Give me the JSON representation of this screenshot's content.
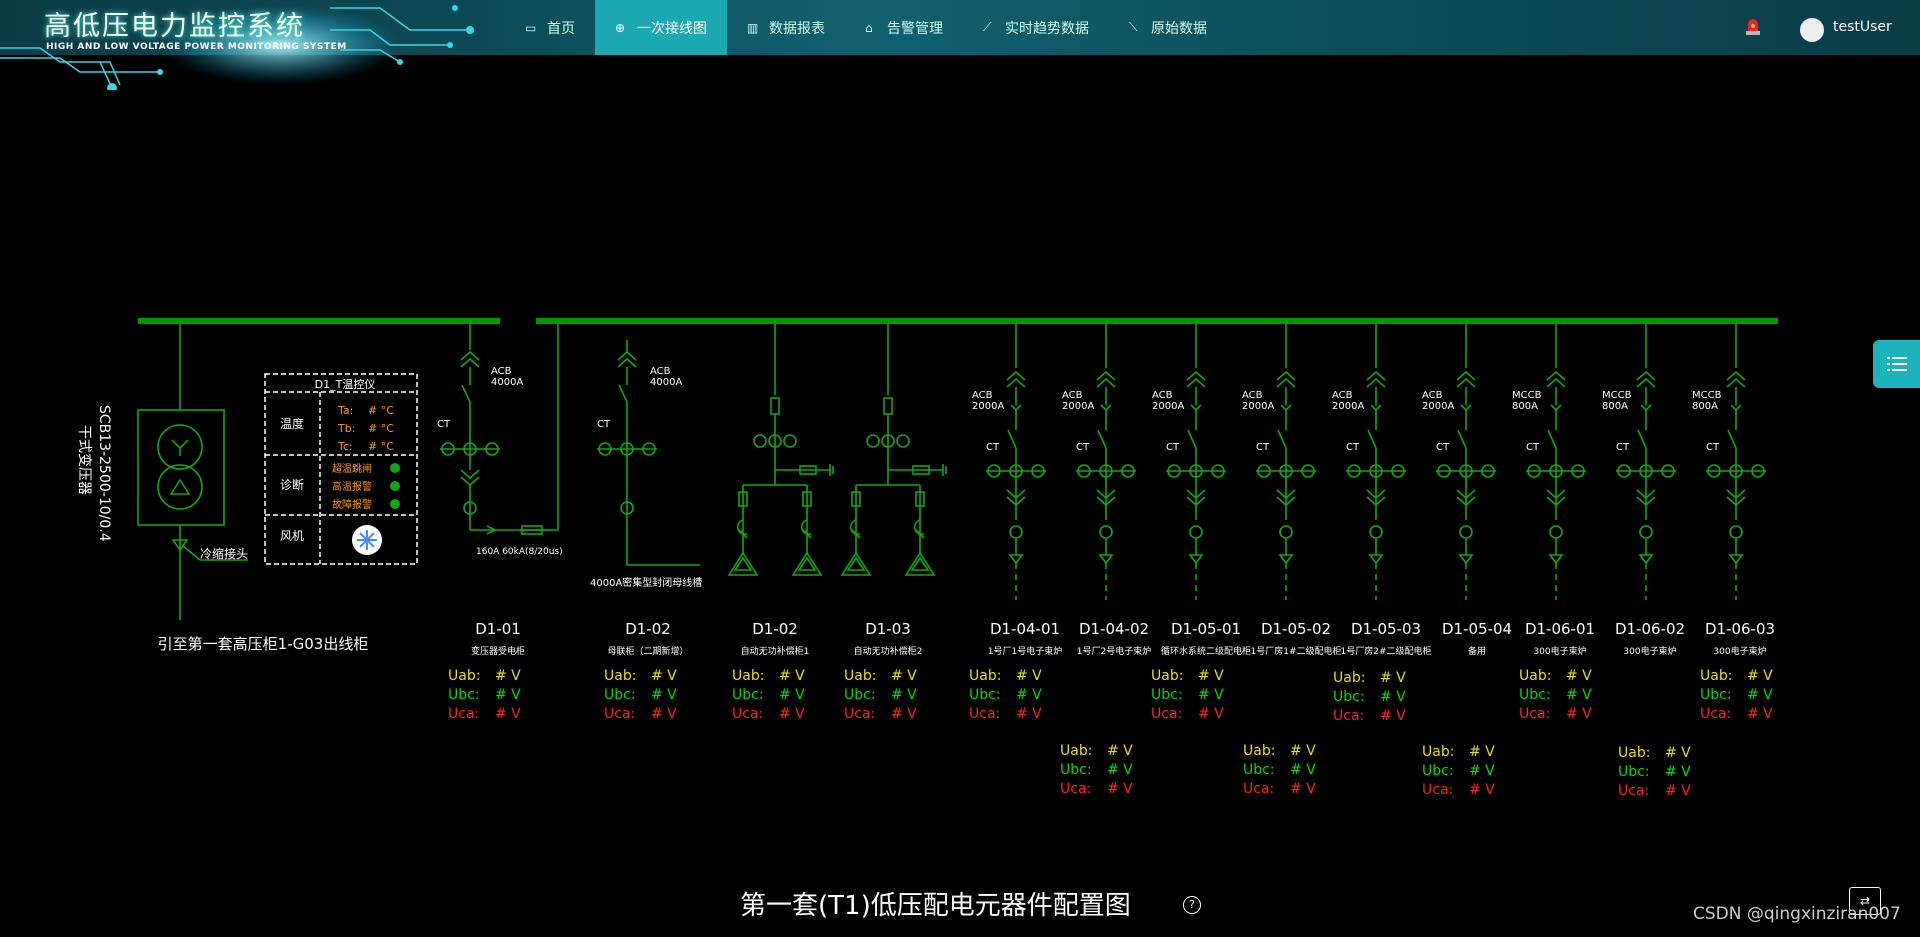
{
  "app": {
    "title": "高低压电力监控系统",
    "subtitle": "HIGH AND LOW VOLTAGE POWER MONITORING SYSTEM"
  },
  "nav": [
    {
      "label": "首页",
      "icon": "monitor-icon"
    },
    {
      "label": "一次接线图",
      "icon": "globe-icon",
      "active": true
    },
    {
      "label": "数据报表",
      "icon": "bar-chart-icon"
    },
    {
      "label": "告警管理",
      "icon": "alarm-icon"
    },
    {
      "label": "实时趋势数据",
      "icon": "trend-icon"
    },
    {
      "label": "原始数据",
      "icon": "raw-data-icon"
    }
  ],
  "user": {
    "name": "testUser"
  },
  "colors": {
    "bus": "#009900",
    "line": "#13a813",
    "yellow": "#e8e000",
    "green": "#00dd00",
    "red": "#ff2020",
    "orange": "#ff9900",
    "accent": "#1ba8b0"
  },
  "transformer": {
    "name": "SCB13-2500-10/0.4",
    "type": "干式变压器",
    "cold_joint": "冷缩接头",
    "feed": "引至第一套高压柜1-G03出线柜"
  },
  "temp_panel": {
    "title": "D1_T温控仪",
    "temp_label": "温度",
    "temps": [
      {
        "label": "Ta:",
        "value": "# °C"
      },
      {
        "label": "Tb:",
        "value": "# °C"
      },
      {
        "label": "Tc:",
        "value": "# °C"
      }
    ],
    "diag_label": "诊断",
    "diags": [
      "超温跳闸",
      "高温报警",
      "故障报警"
    ],
    "fan_label": "风机"
  },
  "labels": {
    "ct": "CT",
    "acb": "ACB",
    "mccb": "MCCB",
    "breaker_note": "160A 60kA(8/20us)",
    "busway": "4000A密集型封闭母线槽"
  },
  "cabinets": [
    {
      "id": "D1-01",
      "desc": "变压器受电柜",
      "rating": "4000A",
      "breaker": "ACB"
    },
    {
      "id": "D1-02",
      "desc": "母联柜（二期新增）",
      "rating": "4000A",
      "breaker": "ACB"
    },
    {
      "id": "D1-02",
      "desc": "自动无功补偿柜1"
    },
    {
      "id": "D1-03",
      "desc": "自动无功补偿柜2"
    },
    {
      "id": "D1-04-01",
      "desc": "1号厂1号电子束炉",
      "rating": "2000A",
      "breaker": "ACB"
    },
    {
      "id": "D1-04-02",
      "desc": "1号厂2号电子束炉",
      "rating": "2000A",
      "breaker": "ACB"
    },
    {
      "id": "D1-05-01",
      "desc": "循环水系统二级配电柜",
      "rating": "2000A",
      "breaker": "ACB"
    },
    {
      "id": "D1-05-02",
      "desc": "1号厂房1#二级配电柜",
      "rating": "2000A",
      "breaker": "ACB"
    },
    {
      "id": "D1-05-03",
      "desc": "1号厂房2#二级配电柜",
      "rating": "2000A",
      "breaker": "ACB"
    },
    {
      "id": "D1-05-04",
      "desc": "备用",
      "rating": "2000A",
      "breaker": "ACB"
    },
    {
      "id": "D1-06-01",
      "desc": "300电子束炉",
      "rating": "800A",
      "breaker": "MCCB"
    },
    {
      "id": "D1-06-02",
      "desc": "300电子束炉",
      "rating": "800A",
      "breaker": "MCCB"
    },
    {
      "id": "D1-06-03",
      "desc": "300电子束炉",
      "rating": "800A",
      "breaker": "MCCB"
    }
  ],
  "volt_labels": {
    "uab": "Uab:",
    "ubc": "Ubc:",
    "uca": "Uca:",
    "value": "# V"
  },
  "page_title": "第一套(T1)低压配电元器件配置图",
  "watermark": "CSDN @qingxinziran007"
}
